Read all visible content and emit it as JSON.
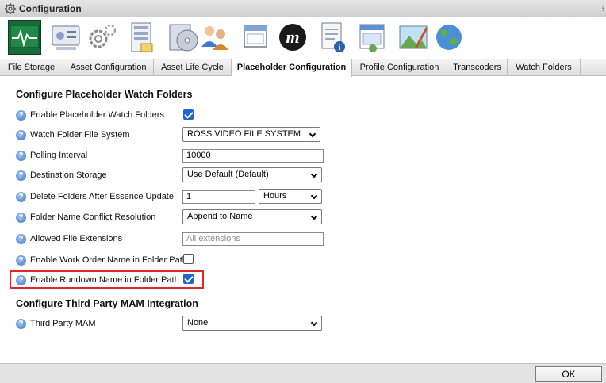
{
  "window": {
    "title": "Configuration",
    "title_icon": "gear-icon"
  },
  "toolbar": {
    "icons": [
      "monitor-waveform-icon",
      "storage-drive-icon",
      "gears-icon",
      "server-icon",
      "disc-media-icon",
      "users-icon",
      "windows-icon",
      "m-logo-icon",
      "document-info-icon",
      "calendar-schedule-icon",
      "landscape-picture-icon",
      "globe-icon"
    ],
    "active_index": 0
  },
  "tabs": [
    {
      "label": "File Storage",
      "active": false
    },
    {
      "label": "Asset Configuration",
      "active": false
    },
    {
      "label": "Asset Life Cycle",
      "active": false
    },
    {
      "label": "Placeholder Configuration",
      "active": true
    },
    {
      "label": "Profile Configuration",
      "active": false
    },
    {
      "label": "Transcoders",
      "active": false
    },
    {
      "label": "Watch Folders",
      "active": false
    }
  ],
  "section1": {
    "title": "Configure Placeholder Watch Folders",
    "fields": {
      "enable_placeholder": {
        "label": "Enable Placeholder Watch Folders",
        "checked": true
      },
      "file_system": {
        "label": "Watch Folder File System",
        "value": "ROSS VIDEO FILE SYSTEM"
      },
      "polling_interval": {
        "label": "Polling Interval",
        "value": "10000"
      },
      "destination_storage": {
        "label": "Destination Storage",
        "value": "Use Default (Default)"
      },
      "delete_folders": {
        "label": "Delete Folders After Essence Update",
        "value": "1",
        "unit": "Hours"
      },
      "conflict_resolution": {
        "label": "Folder Name Conflict Resolution",
        "value": "Append to Name"
      },
      "allowed_extensions": {
        "label": "Allowed File Extensions",
        "value": "",
        "placeholder": "All extensions"
      },
      "work_order_name": {
        "label": "Enable Work Order Name in Folder Path",
        "checked": false
      },
      "rundown_name": {
        "label": "Enable Rundown Name in Folder Path",
        "checked": true
      }
    }
  },
  "section2": {
    "title": "Configure Third Party MAM Integration",
    "fields": {
      "third_party_mam": {
        "label": "Third Party MAM",
        "value": "None"
      }
    }
  },
  "footer": {
    "ok_label": "OK"
  },
  "colors": {
    "highlight": "#e0262a",
    "check_blue": "#1f66d1",
    "help_blue": "#3f78c8",
    "active_icon_bg": "#1a6b3a"
  }
}
